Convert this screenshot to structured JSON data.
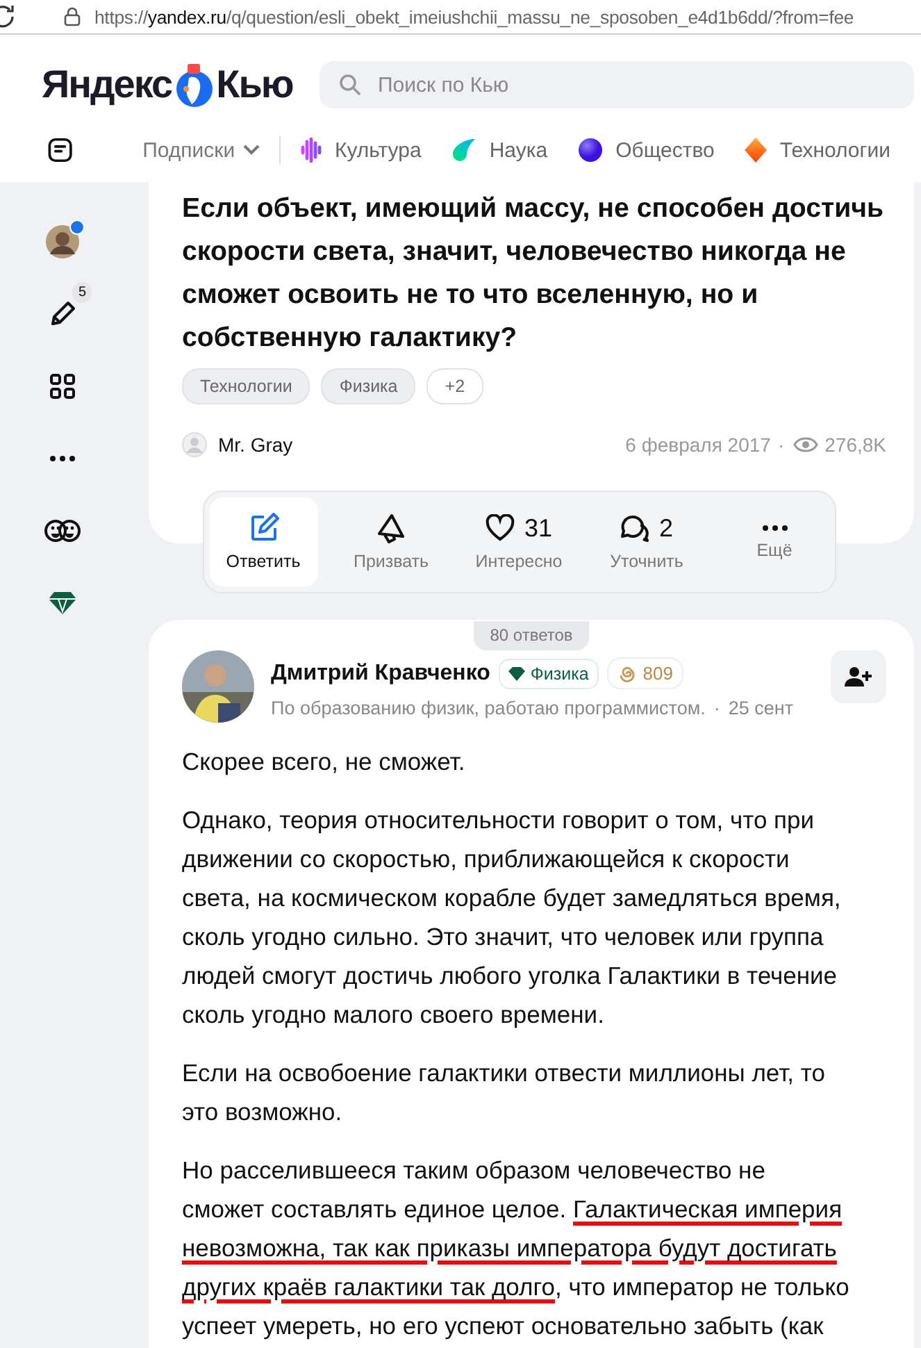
{
  "browser": {
    "url_prefix": "https://",
    "url_host": "yandex.ru",
    "url_path": "/q/question/esli_obekt_imeiushchii_massu_ne_sposoben_e4d1b6dd/?from=fee"
  },
  "header": {
    "logo_left": "Яндекс",
    "logo_right": "Кью",
    "search": {
      "placeholder": "Поиск по Кью"
    }
  },
  "nav": {
    "subscriptions": "Подписки",
    "topics": [
      {
        "label": "Культура",
        "kind": "wave"
      },
      {
        "label": "Наука",
        "kind": "drop"
      },
      {
        "label": "Общество",
        "kind": "ball"
      },
      {
        "label": "Технологии",
        "kind": "diamond"
      }
    ]
  },
  "sidebar": {
    "items": [
      {
        "kind": "avatar",
        "dot": true
      },
      {
        "kind": "pencil",
        "badge": "5"
      },
      {
        "kind": "grid"
      },
      {
        "kind": "more"
      },
      {
        "kind": "faces"
      },
      {
        "kind": "gem"
      }
    ]
  },
  "question": {
    "title": "Если объект, имеющий массу, не способен достичь скорости света, значит, человечество никогда не сможет освоить не то что вселенную, но и собственную галактику?",
    "tags": [
      {
        "label": "Технологии",
        "kind": "filled"
      },
      {
        "label": "Физика",
        "kind": "filled"
      },
      {
        "label": "+2",
        "kind": "outline"
      }
    ],
    "author": "Mr. Gray",
    "date": "6 февраля 2017",
    "separator": "·",
    "views": "276,8K"
  },
  "actions": [
    {
      "kind": "edit",
      "label": "Ответить",
      "selected": true
    },
    {
      "kind": "megaphone",
      "label": "Призвать",
      "selected": false
    },
    {
      "kind": "heart",
      "count": "31",
      "label": "Интересно",
      "selected": false
    },
    {
      "kind": "comments",
      "count": "2",
      "label": "Уточнить",
      "selected": false
    },
    {
      "kind": "more",
      "label": "Ещё",
      "selected": false
    }
  ],
  "answers_count": "80 ответов",
  "answer": {
    "author": "Дмитрий Кравченко",
    "expert_badge": "Физика",
    "score": "809",
    "bio": "По образованию физик, работаю программистом.",
    "separator": "·",
    "date": "25 сент",
    "paragraphs": [
      [
        {
          "text": "Скорее всего, не сможет.",
          "underlined": false
        }
      ],
      [
        {
          "text": "Однако, теория относительности говорит о том, что при движении со скоростью, приближающейся к скорости света, на космическом корабле будет замедляться время, сколь угодно сильно. Это значит, что человек или группа людей смогут достичь любого уголка Галактики в течение сколь угодно малого своего времени.",
          "underlined": false
        }
      ],
      [
        {
          "text": "Если на освобоение галактики отвести миллионы лет, то это возможно.",
          "underlined": false
        }
      ],
      [
        {
          "text": "Но расселившееся таким образом человечество не сможет составлять единое целое. ",
          "underlined": false
        },
        {
          "text": "Галактическая империя невозможна, так как приказы императора будут достигать других краёв галактики так долго",
          "underlined": true
        },
        {
          "text": ", что император не только успеет умереть, но его успеют основательно забыть (как",
          "underlined": false
        }
      ]
    ]
  }
}
